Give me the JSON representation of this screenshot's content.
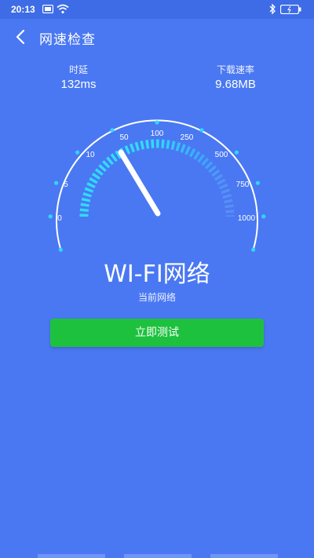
{
  "status_bar": {
    "time": "20:13",
    "icons": [
      "notification-icon",
      "wifi-icon",
      "bluetooth-icon",
      "battery-icon"
    ]
  },
  "header": {
    "title": "网速检查",
    "back_icon": "chevron-left-icon"
  },
  "stats": {
    "latency": {
      "label": "时延",
      "value": "132ms"
    },
    "download": {
      "label": "下载速率",
      "value": "9.68MB"
    }
  },
  "gauge": {
    "scale_labels": [
      "0",
      "5",
      "10",
      "50",
      "100",
      "250",
      "500",
      "750",
      "1000"
    ]
  },
  "network": {
    "name": "WI-FI网络",
    "caption": "当前网络"
  },
  "actions": {
    "test_button": "立即测试"
  },
  "colors": {
    "background": "#4a78f2",
    "status_bar": "#3e6ce6",
    "accent_cyan": "#32d6ff",
    "button_green": "#1ec13e"
  }
}
